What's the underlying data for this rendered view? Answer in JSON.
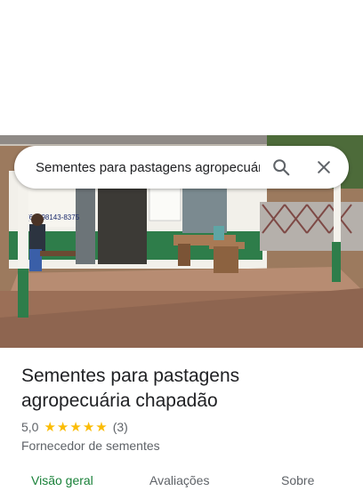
{
  "search": {
    "query": "Sementes para pastagens agropecuária chapadão"
  },
  "place": {
    "name": "Sementes para pastagens agropecuária chapadão",
    "rating": "5,0",
    "stars": 5,
    "review_count": "(3)",
    "category": "Fornecedor de sementes",
    "photo_sign_text": "(64) 98143-8375"
  },
  "tabs": [
    {
      "label": "Visão geral",
      "active": true
    },
    {
      "label": "Avaliações",
      "active": false
    },
    {
      "label": "Sobre",
      "active": false
    }
  ],
  "icons": {
    "search": "search-icon",
    "close": "close-icon",
    "star": "star-icon"
  },
  "colors": {
    "accent": "#188038",
    "star": "#fbbc04",
    "text": "#202124",
    "secondary": "#5f6368"
  }
}
